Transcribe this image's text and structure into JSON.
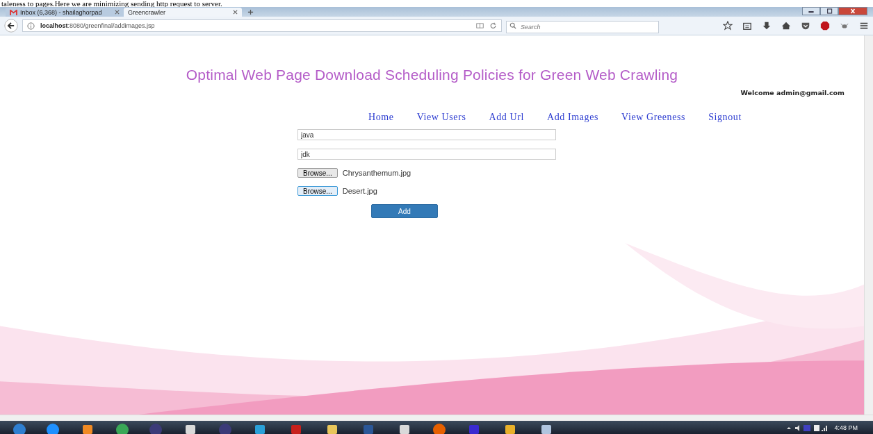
{
  "document_caption": "taleness to pages.Here we are minimizing sending http request to server.",
  "browser": {
    "tabs": [
      {
        "label": "Inbox (6,368) - shailaghorpad",
        "selected": false,
        "kind": "mail"
      },
      {
        "label": "Greencrawler",
        "selected": true,
        "kind": "page"
      }
    ],
    "url": {
      "host": "localhost",
      "rest": ":8080/greenfinal/addimages.jsp"
    },
    "search": {
      "placeholder": "Search"
    }
  },
  "page": {
    "title": "Optimal Web Page Download Scheduling Policies for Green Web Crawling",
    "welcome": "Welcome admin@gmail.com",
    "nav": [
      "Home",
      "View Users",
      "Add Url",
      "Add Images",
      "View Greeness",
      "Signout"
    ],
    "fields": [
      {
        "value": "java"
      },
      {
        "value": "jdk"
      }
    ],
    "files": [
      {
        "button": "Browse...",
        "file": "Chrysanthemum.jpg",
        "focused": false
      },
      {
        "button": "Browse...",
        "file": "Desert.jpg",
        "focused": true
      }
    ],
    "submit": "Add"
  },
  "taskbar": {
    "apps": [
      {
        "kind": "start"
      },
      {
        "kind": "ie"
      },
      {
        "kind": "media"
      },
      {
        "kind": "chrome"
      },
      {
        "kind": "eclipse"
      },
      {
        "kind": "tool"
      },
      {
        "kind": "eclipse"
      },
      {
        "kind": "bolt"
      },
      {
        "kind": "pdf"
      },
      {
        "kind": "folder"
      },
      {
        "kind": "word"
      },
      {
        "kind": "tool"
      },
      {
        "kind": "firefox"
      },
      {
        "kind": "paint"
      },
      {
        "kind": "phone"
      },
      {
        "kind": "scissors"
      }
    ],
    "clock": "4:48 PM"
  }
}
